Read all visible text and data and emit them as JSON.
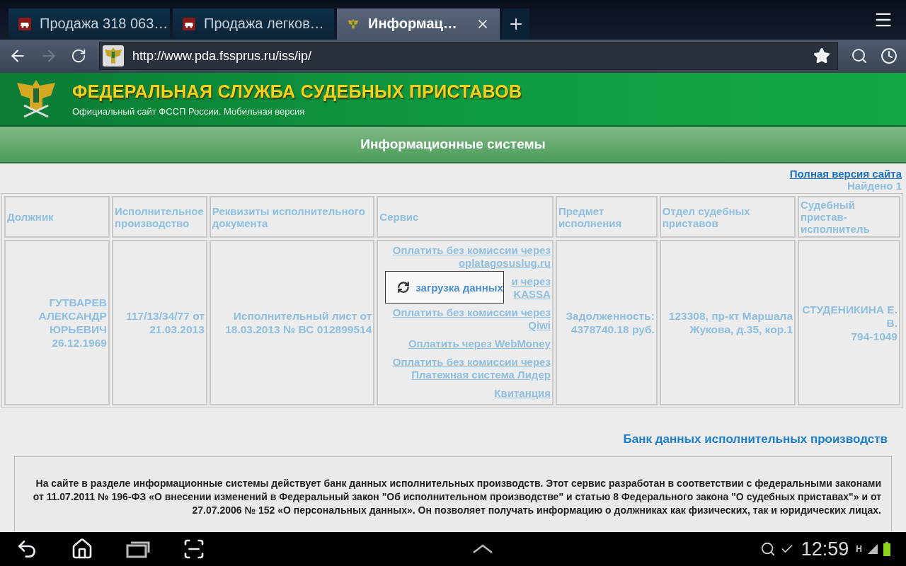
{
  "browser": {
    "tabs": [
      {
        "title": "Продажа 318 063…",
        "kind": "car",
        "selected": false
      },
      {
        "title": "Продажа легков…",
        "kind": "car",
        "selected": false
      },
      {
        "title": "Информац…",
        "kind": "emblem",
        "selected": true
      }
    ],
    "url": "http://www.pda.fssprus.ru/iss/ip/"
  },
  "site_header": {
    "title": "ФЕДЕРАЛЬНАЯ СЛУЖБА СУДЕБНЫХ ПРИСТАВОВ",
    "subtitle": "Официальный сайт ФССП России. Мобильная версия"
  },
  "page_title": "Информационные системы",
  "full_version_link": "Полная версия сайта",
  "found": "Найдено 1",
  "table": {
    "columns": [
      "Должник",
      "Исполнительное производство",
      "Реквизиты исполнительного документа",
      "Сервис",
      "Предмет исполнения",
      "Отдел судебных приставов",
      "Судебный пристав-исполнитель"
    ],
    "rows": [
      {
        "cells": [
          {
            "kind": "text",
            "lines": [
              "ГУТВАРЕВ",
              "АЛЕКСАНДР",
              "ЮРЬЕВИЧ",
              "26.12.1969"
            ]
          },
          {
            "kind": "text",
            "lines": [
              "117/13/34/77 от",
              "21.03.2013"
            ]
          },
          {
            "kind": "text",
            "lines": [
              "Исполнительный лист от",
              "18.03.2013 № ВС 012899514"
            ]
          },
          {
            "kind": "links",
            "links": [
              [
                "Оплатить без комиссии через",
                "oplatagosuslug.ru"
              ],
              [
                "и через",
                "KASSA"
              ],
              [
                "Оплатить без комиссии через",
                "Qiwi"
              ],
              [
                "Оплатить через WebMoney"
              ],
              [
                "Оплатить без комиссии через",
                "Платежная система Лидер"
              ],
              [
                "Квитанция"
              ]
            ]
          },
          {
            "kind": "text",
            "lines": [
              "Задолженность:",
              "4378740.18 руб."
            ]
          },
          {
            "kind": "text",
            "lines": [
              "123308, пр-кт Маршала",
              "Жукова, д.35, кор.1"
            ]
          },
          {
            "kind": "text",
            "lines": [
              "СТУДЕНИКИНА Е.",
              "В.",
              "794-1049"
            ]
          }
        ]
      }
    ]
  },
  "loading_popup": {
    "text": "загрузка данных"
  },
  "section_link": "Банк данных исполнительных производств",
  "description": "На сайте в разделе информационные системы действует банк данных исполнительных производств. Этот сервис разработан в соответствии с федеральными законами от 11.07.2011 № 196-ФЗ «О внесении изменений в Федеральный закон \"Об исполнительном производстве\" и статью 8 Федерального закона \"О судебных приставах\"» и от 27.07.2006 № 152 «О персональных данных». Он позволяет получать информацию о должниках как физических, так и юридических лицах.",
  "status_bar": {
    "time": "12:59",
    "network": "H"
  }
}
